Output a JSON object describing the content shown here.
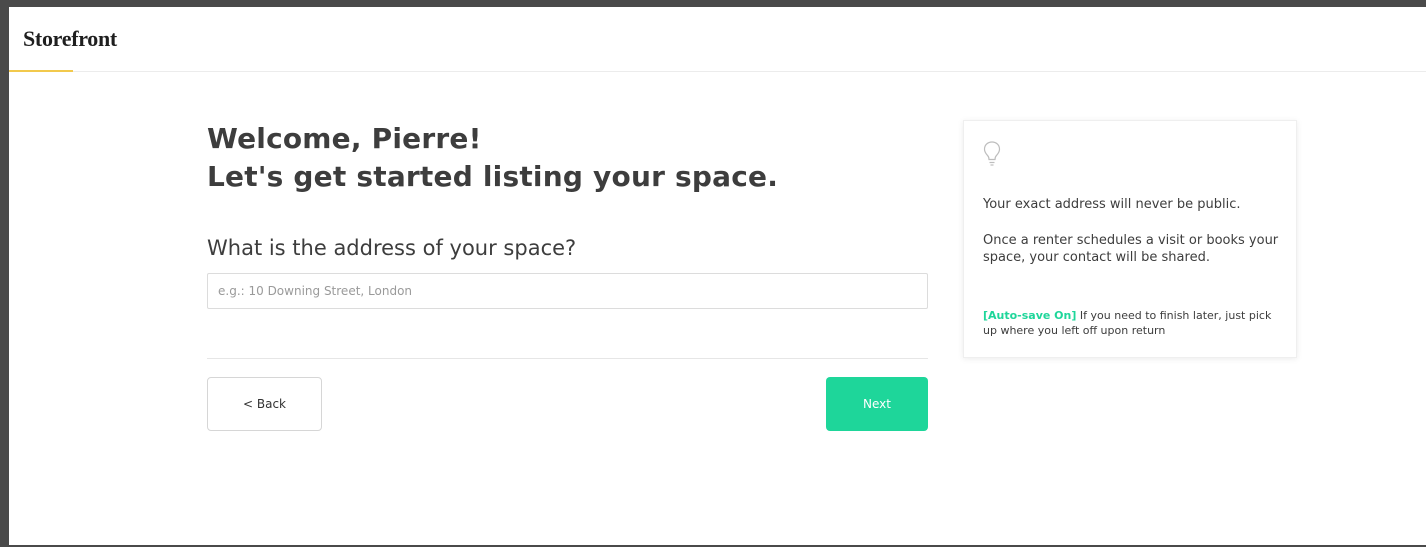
{
  "header": {
    "logo": "Storefront"
  },
  "main": {
    "heading_line1": "Welcome, Pierre!",
    "heading_line2": "Let's get started listing your space.",
    "question": "What is the address of your space?",
    "address_input": {
      "value": "",
      "placeholder": "e.g.: 10 Downing Street, London"
    },
    "back_label": "< Back",
    "next_label": "Next"
  },
  "info_card": {
    "icon": "lightbulb-icon",
    "paragraph1": "Your exact address will never be public.",
    "paragraph2": "Once a renter schedules a visit or books your space, your contact will be shared.",
    "autosave_tag": "[Auto-save On]",
    "autosave_text": " If you need to finish later, just pick up where you left off upon return"
  },
  "colors": {
    "accent": "#1ed69a",
    "logo_underline": "#f2c94c",
    "text": "#3d3d3d"
  }
}
